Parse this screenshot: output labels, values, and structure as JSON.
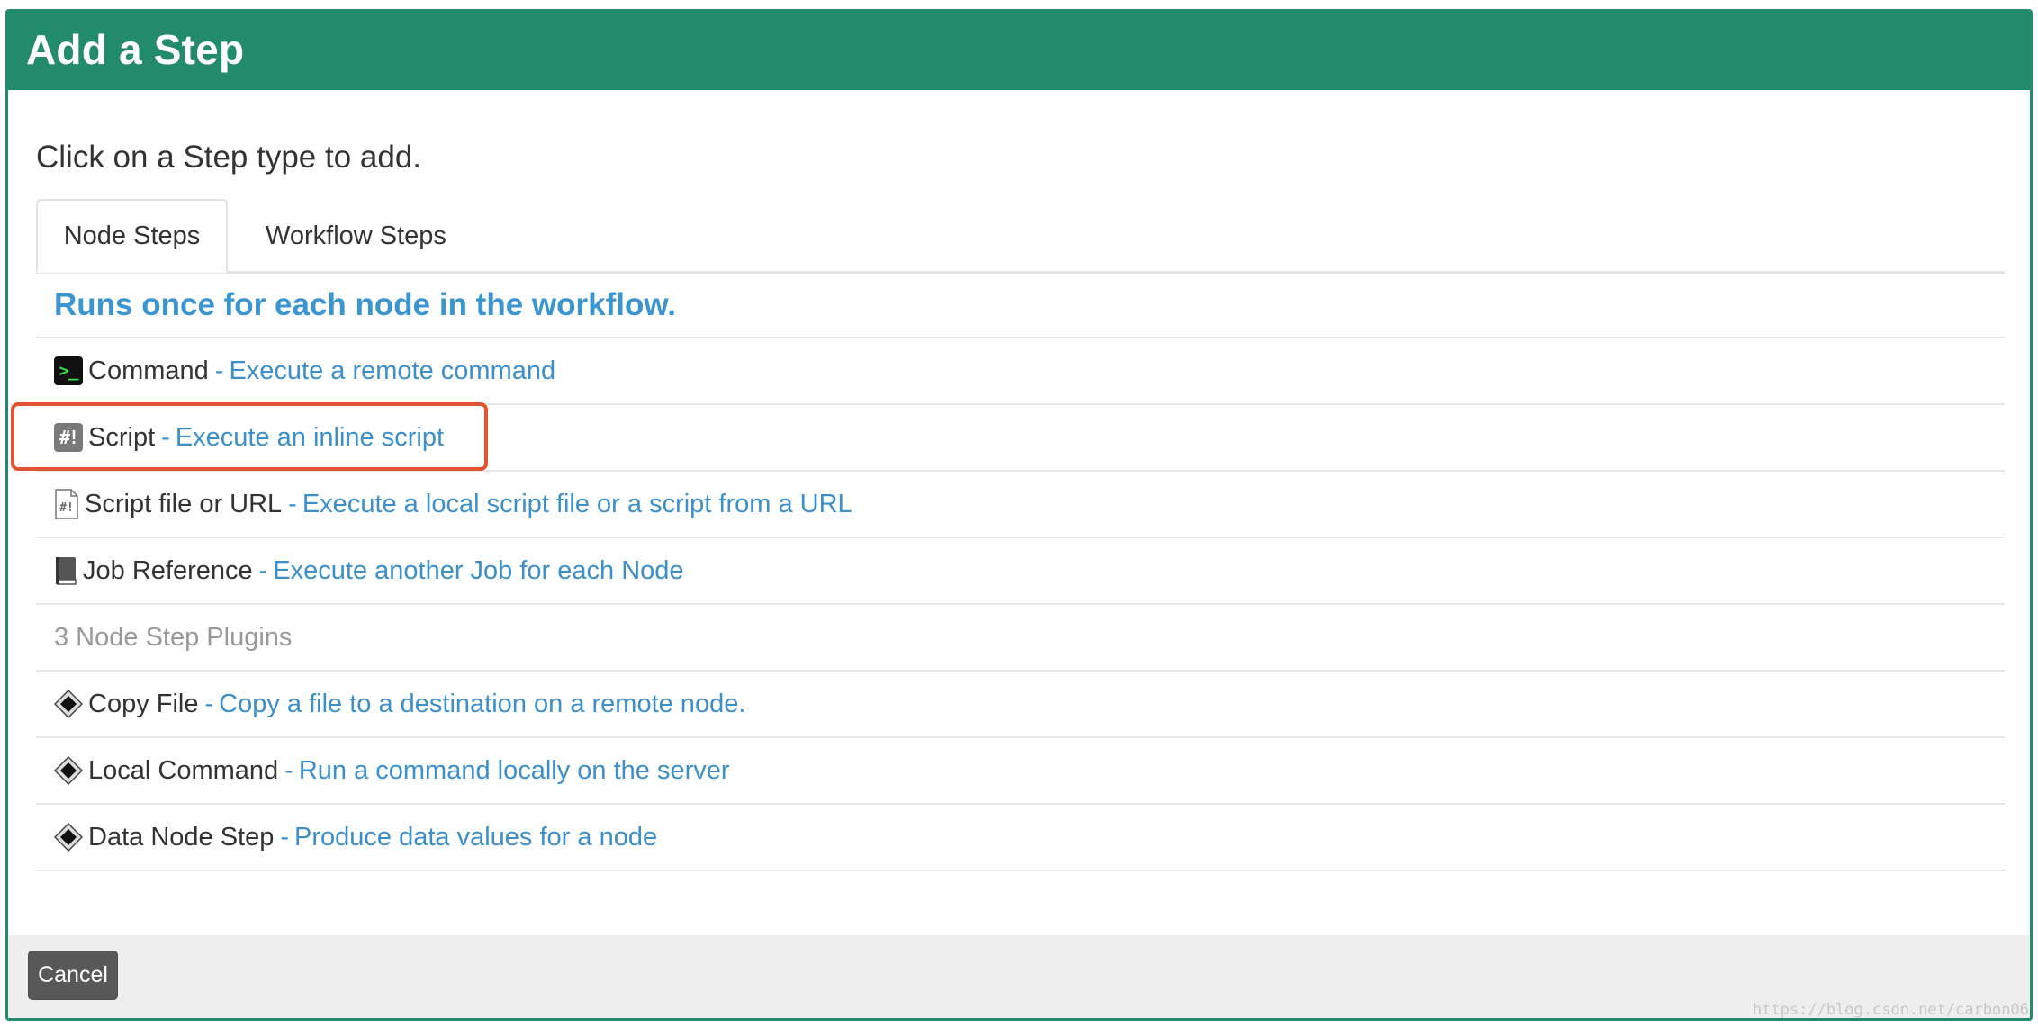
{
  "dialog": {
    "title": "Add a Step",
    "instruction": "Click on a Step type to add."
  },
  "tabs": [
    {
      "label": "Node Steps",
      "active": true
    },
    {
      "label": "Workflow Steps",
      "active": false
    }
  ],
  "node_steps": {
    "header": "Runs once for each node in the workflow.",
    "items": [
      {
        "icon": "terminal-icon",
        "name": "Command",
        "description": "Execute a remote command"
      },
      {
        "icon": "script-icon",
        "name": "Script",
        "description": "Execute an inline script",
        "highlighted": true
      },
      {
        "icon": "script-file-icon",
        "name": "Script file or URL",
        "description": "Execute a local script file or a script from a URL"
      },
      {
        "icon": "book-icon",
        "name": "Job Reference",
        "description": "Execute another Job for each Node"
      }
    ],
    "plugins_label": "3 Node Step Plugins",
    "plugins": [
      {
        "icon": "diamond-icon",
        "name": "Copy File",
        "description": "Copy a file to a destination on a remote node."
      },
      {
        "icon": "diamond-icon",
        "name": "Local Command",
        "description": "Run a command locally on the server"
      },
      {
        "icon": "diamond-icon",
        "name": "Data Node Step",
        "description": "Produce data values for a node"
      }
    ],
    "separator": "-"
  },
  "footer": {
    "cancel_label": "Cancel"
  },
  "watermark": "https://blog.csdn.net/carbon06",
  "colors": {
    "header": "#218b6c",
    "link": "#3b8fcb",
    "highlight": "#e2542f"
  }
}
